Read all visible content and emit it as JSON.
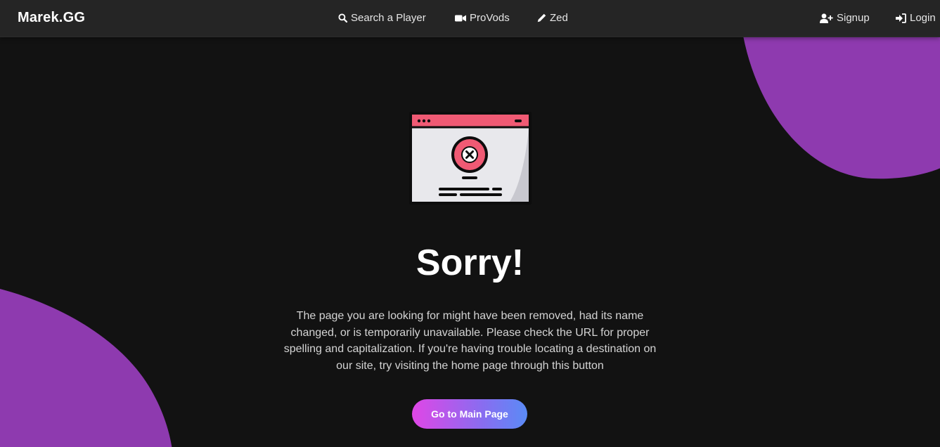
{
  "brand": {
    "logo_text": "Marek.GG",
    "blob_color": "#8e3aaf"
  },
  "nav": {
    "search": {
      "label": "Search a Player",
      "icon": "search-icon"
    },
    "provods": {
      "label": "ProVods",
      "icon": "video-camera-icon"
    },
    "zed": {
      "label": "Zed",
      "icon": "pencil-icon"
    },
    "signup": {
      "label": "Signup",
      "icon": "user-plus-icon"
    },
    "login": {
      "label": "Login",
      "icon": "sign-in-icon"
    }
  },
  "main": {
    "illustration": "browser-error-icon",
    "title": "Sorry!",
    "message": "The page you are looking for might have been removed, had its name changed, or is temporarily unavailable. Please check the URL for proper spelling and capitalization. If you're having trouble locating a destination on our site, try visiting the home page through this button",
    "button_label": "Go to Main Page"
  }
}
